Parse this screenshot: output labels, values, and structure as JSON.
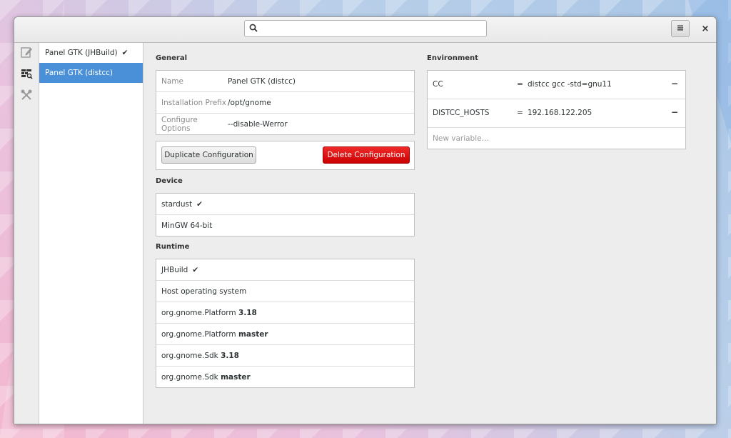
{
  "header": {
    "search_placeholder": "",
    "search_icon": "search-icon",
    "menu_icon": "hamburger-menu-icon",
    "close_label": "×"
  },
  "iconbar": {
    "items": [
      {
        "icon": "edit-icon"
      },
      {
        "icon": "build-configuration-icon"
      },
      {
        "icon": "tools-icon"
      }
    ]
  },
  "sidebar": {
    "items": [
      {
        "label": "Panel GTK (JHBuild)",
        "check": "✔",
        "selected": false
      },
      {
        "label": "Panel GTK (distcc)",
        "check": "",
        "selected": true
      }
    ]
  },
  "general": {
    "title": "General",
    "fields": [
      {
        "label": "Name",
        "value": "Panel GTK (distcc)"
      },
      {
        "label": "Installation Prefix",
        "value": "/opt/gnome"
      },
      {
        "label": "Configure Options",
        "value": "--disable-Werror"
      }
    ],
    "duplicate_label": "Duplicate Configuration",
    "delete_label": "Delete Configuration"
  },
  "device": {
    "title": "Device",
    "items": [
      {
        "label": "stardust",
        "check": "✔"
      },
      {
        "label": "MinGW 64-bit",
        "check": ""
      }
    ]
  },
  "runtime": {
    "title": "Runtime",
    "items": [
      {
        "label": "JHBuild",
        "bold": "",
        "check": "✔"
      },
      {
        "label": "Host operating system",
        "bold": "",
        "check": ""
      },
      {
        "label": "org.gnome.Platform ",
        "bold": "3.18",
        "check": ""
      },
      {
        "label": "org.gnome.Platform ",
        "bold": "master",
        "check": ""
      },
      {
        "label": "org.gnome.Sdk ",
        "bold": "3.18",
        "check": ""
      },
      {
        "label": "org.gnome.Sdk ",
        "bold": "master",
        "check": ""
      }
    ]
  },
  "environment": {
    "title": "Environment",
    "variables": [
      {
        "key": "CC",
        "eq": "=",
        "value": "distcc gcc -std=gnu11",
        "remove": "−"
      },
      {
        "key": "DISTCC_HOSTS",
        "eq": "=",
        "value": "192.168.122.205",
        "remove": "−"
      }
    ],
    "new_placeholder": "New variable…"
  },
  "colors": {
    "selection": "#4a90d9",
    "danger": "#cc0000"
  }
}
